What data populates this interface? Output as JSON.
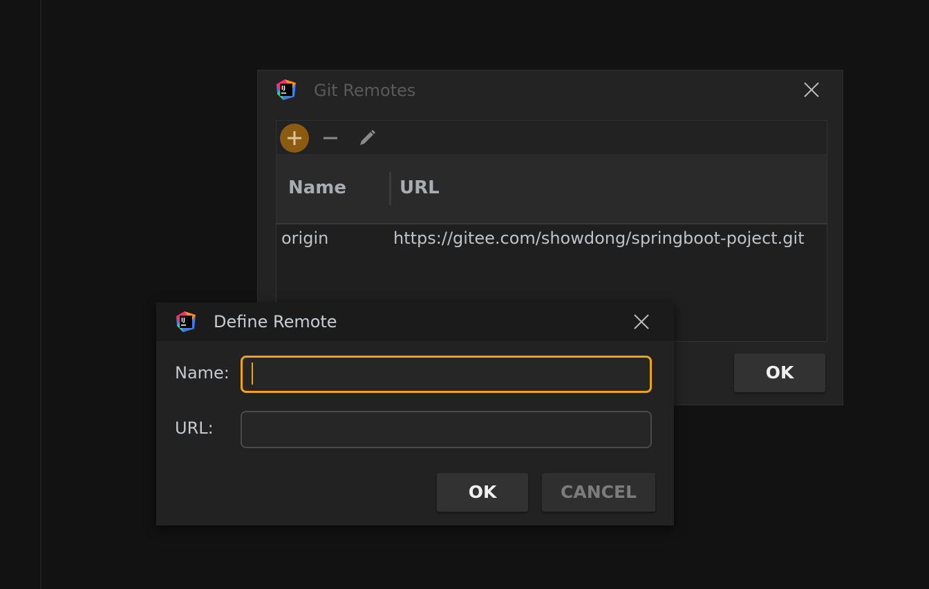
{
  "git_remotes": {
    "title": "Git Remotes",
    "toolbar": {
      "add_icon": "plus-icon",
      "remove_icon": "minus-icon",
      "edit_icon": "pencil-icon"
    },
    "columns": [
      "Name",
      "URL"
    ],
    "rows": [
      {
        "name": "origin",
        "url": "https://gitee.com/showdong/springboot-poject.git"
      }
    ],
    "ok_label": "OK"
  },
  "define_remote": {
    "title": "Define Remote",
    "name_label": "Name:",
    "name_value": "",
    "url_label": "URL:",
    "url_value": "",
    "ok_label": "OK",
    "cancel_label": "CANCEL"
  },
  "colors": {
    "accent": "#f1a317",
    "add_button": "#8c5b12",
    "background": "#121212",
    "dialog": "#232323"
  }
}
